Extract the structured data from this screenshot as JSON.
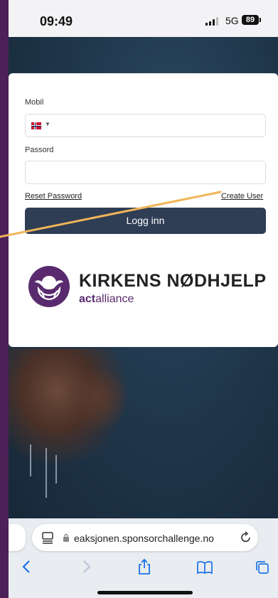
{
  "status_bar": {
    "time": "09:49",
    "network": "5G",
    "battery": "89"
  },
  "login": {
    "mobile_label": "Mobil",
    "mobile_value": "",
    "password_label": "Passord",
    "password_value": "",
    "reset_password": "Reset Password",
    "create_user": "Create User",
    "login_button": "Logg inn"
  },
  "logo": {
    "name": "KIRKENS NØDHJELP",
    "tagline_bold": "act",
    "tagline_rest": "alliance"
  },
  "browser": {
    "url": "eaksjonen.sponsorchallenge.no"
  },
  "colors": {
    "button": "#2f3d55",
    "brand_purple": "#5a2a6e",
    "annotation_line": "#f0b557",
    "outer_background": "#4b2158"
  }
}
